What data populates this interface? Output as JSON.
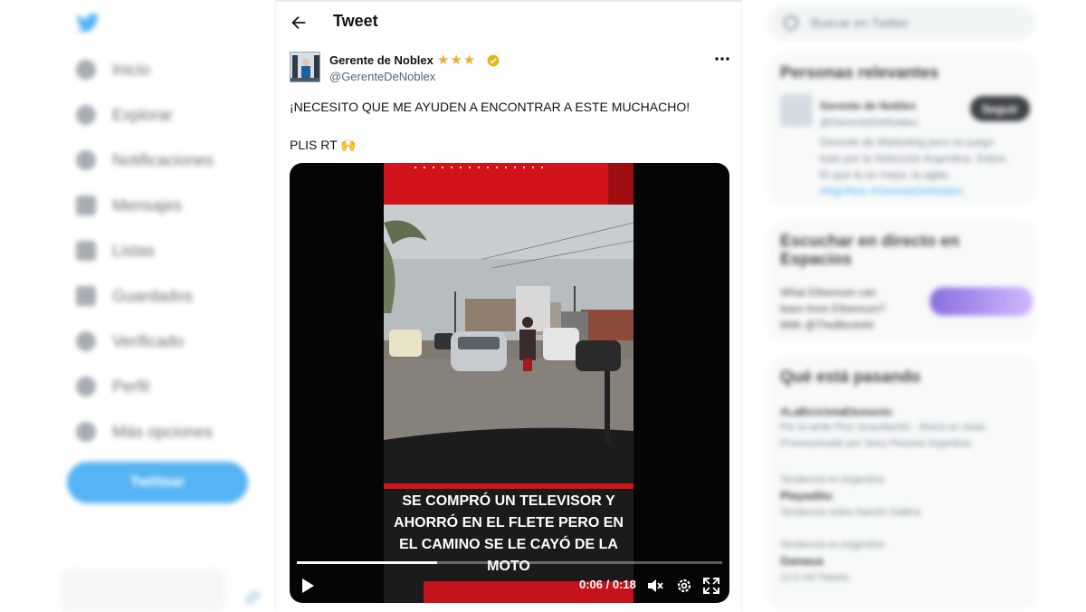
{
  "nav": {
    "items": [
      {
        "label": "Inicio",
        "icon": "home-icon"
      },
      {
        "label": "Explorar",
        "icon": "search-icon"
      },
      {
        "label": "Notificaciones",
        "icon": "bell-icon"
      },
      {
        "label": "Mensajes",
        "icon": "mail-icon"
      },
      {
        "label": "Listas",
        "icon": "list-icon"
      },
      {
        "label": "Guardados",
        "icon": "bookmark-icon"
      },
      {
        "label": "Verificado",
        "icon": "verified-icon"
      },
      {
        "label": "Perfil",
        "icon": "profile-icon"
      },
      {
        "label": "Más opciones",
        "icon": "more-circle-icon"
      }
    ],
    "tweet_button": "Twittear"
  },
  "header": {
    "title": "Tweet"
  },
  "tweet": {
    "author_name": "Gerente de Noblex",
    "author_stars": "★★★",
    "author_handle": "@GerenteDeNoblex",
    "text_line1": "¡NECESITO QUE ME AYUDEN A ENCONTRAR A ESTE MUCHACHO!",
    "text_line2": "PLIS RT 🙌"
  },
  "video": {
    "caption": [
      "SE COMPRÓ UN TELEVISOR Y",
      "AHORRÓ EN EL FLETE  PERO EN",
      "EL CAMINO SE LE CAYÓ DE LA",
      "MOTO"
    ],
    "time": "0:06 / 0:18",
    "progress": 0.33
  },
  "right": {
    "search_placeholder": "Buscar en Twitter",
    "relevant_title": "Personas relevantes",
    "relevant_name": "Gerente de Noblex",
    "relevant_handle": "@GerenteDeNoblex",
    "follow_label": "Seguir",
    "bio_line1": "Gerente de Marketing pero es juego",
    "bio_line2": "todo por la Selección Argentina. Sobre.",
    "bio_line3": "El que la se mejor, la agita.",
    "bio_link": "#NgUNos #GerenteDeNoblex",
    "spaces_title_1": "Escuchar en directo en",
    "spaces_title_2": "Espacios",
    "spaces_text1": "What Ethereum can",
    "spaces_text2": "learn from Ethereum?",
    "spaces_text3": "With @TheBlockAir",
    "trends_title": "Qué está pasando",
    "trend1_name": "#LaBicicletaElemento",
    "trend1_meta1": "Por la tarde Plus recaudación · Ahora en vivas",
    "trend1_meta2": "Promocionado por Sony Pictures Argentina",
    "trend2_cat": "Tendencia en Argentina",
    "trend2_name": "Playaditu",
    "trend2_meta": "Tendencia sobre Nación Gallina",
    "trend3_cat": "Tendencia en Argentina",
    "trend3_name": "Ganaua",
    "trend3_meta": "12,5 mil Tweets"
  }
}
